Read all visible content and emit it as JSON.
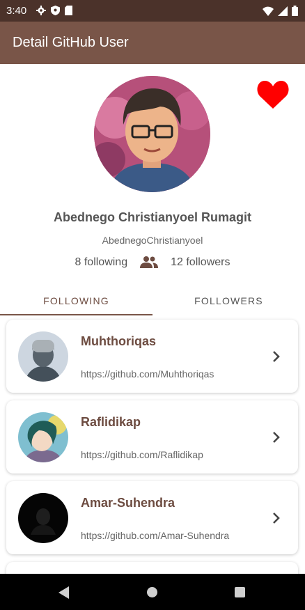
{
  "status_bar": {
    "time": "3:40",
    "icons_left": [
      "settings-icon",
      "shield-icon",
      "sd-card-icon"
    ],
    "icons_right": [
      "wifi-icon",
      "signal-icon",
      "battery-icon"
    ]
  },
  "app_bar": {
    "title": "Detail GitHub User",
    "color": "#795548"
  },
  "profile": {
    "name": "Abednego Christianyoel Rumagit",
    "username": "AbednegoChristianyoel",
    "following": "8 following",
    "followers": "12 followers",
    "favorite_icon": "heart-icon",
    "favorite_color": "#ff0000"
  },
  "tabs": [
    {
      "label": "FOLLOWING",
      "selected": true
    },
    {
      "label": "FOLLOWERS",
      "selected": false
    }
  ],
  "list": [
    {
      "name": "Muhthoriqas",
      "url": "https://github.com/Muhthoriqas"
    },
    {
      "name": "Raflidikap",
      "url": "https://github.com/Raflidikap"
    },
    {
      "name": "Amar-Suhendra",
      "url": "https://github.com/Amar-Suhendra"
    }
  ],
  "nav_bar": {
    "icons": [
      "back-icon",
      "home-icon",
      "recents-icon"
    ]
  }
}
